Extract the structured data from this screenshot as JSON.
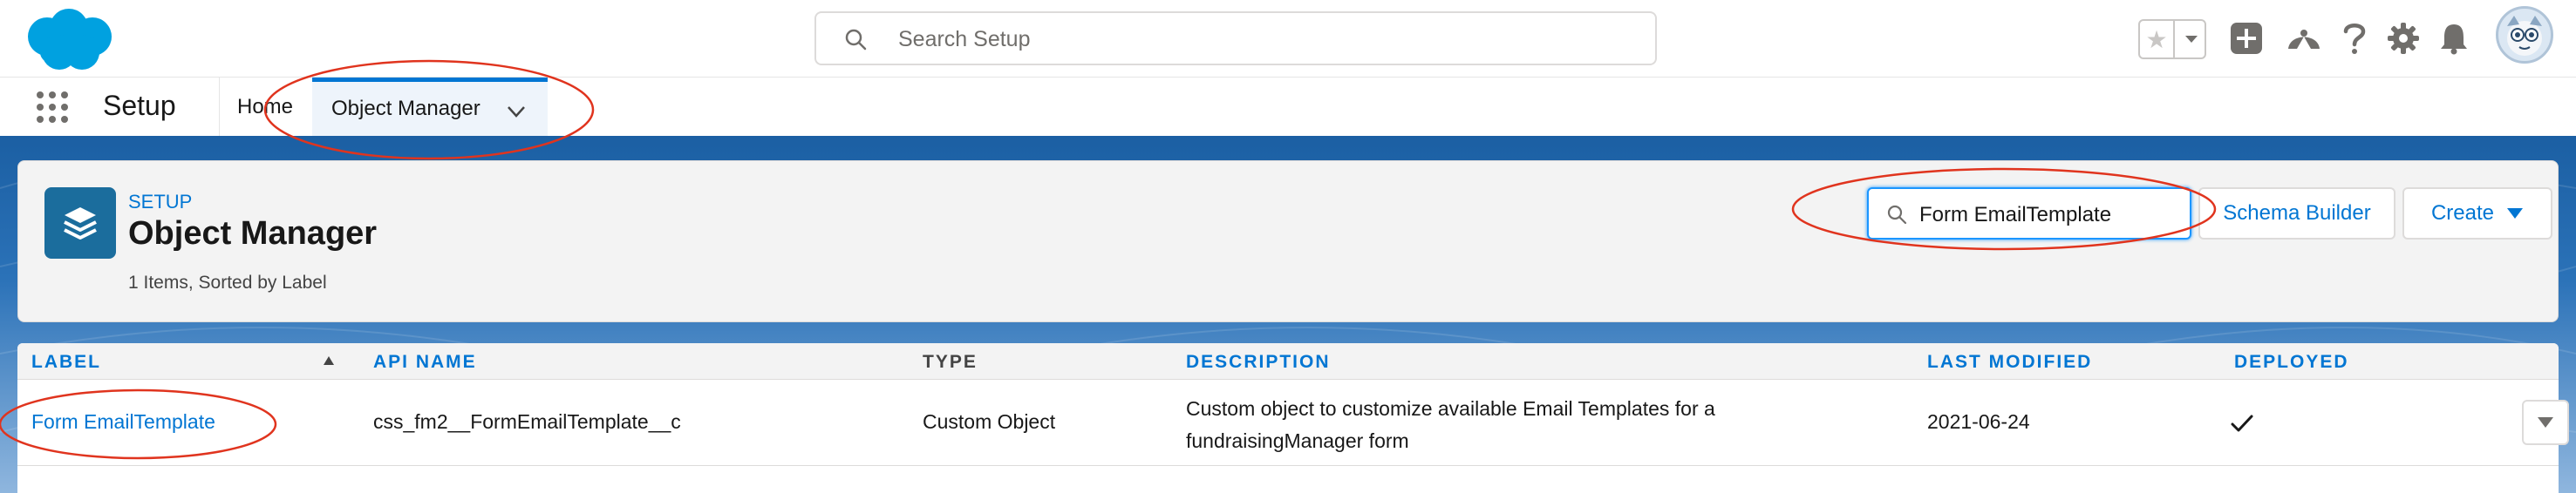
{
  "global_header": {
    "search_placeholder": "Search Setup"
  },
  "context_bar": {
    "app_name": "Setup",
    "tabs": [
      {
        "label": "Home"
      },
      {
        "label": "Object Manager"
      }
    ]
  },
  "page_header": {
    "eyebrow": "SETUP",
    "title": "Object Manager",
    "meta": "1 Items, Sorted by Label",
    "quick_find_value": "Form EmailTemplate",
    "schema_builder_label": "Schema Builder",
    "create_label": "Create"
  },
  "table": {
    "columns": [
      "LABEL",
      "API NAME",
      "TYPE",
      "DESCRIPTION",
      "LAST MODIFIED",
      "DEPLOYED"
    ],
    "rows": [
      {
        "label": "Form EmailTemplate",
        "api_name": "css_fm2__FormEmailTemplate__c",
        "type": "Custom Object",
        "description_line1": "Custom object to customize available Email Templates for a",
        "description_line2": "fundraisingManager form",
        "last_modified": "2021-06-24",
        "deployed": true
      }
    ]
  },
  "colors": {
    "brand_blue": "#0176d3",
    "annotation_red": "#e0341e",
    "header_band": "#1b5fa3"
  },
  "icons": [
    "salesforce-cloud-logo",
    "search-icon",
    "star-icon",
    "add-icon",
    "trailhead-icon",
    "help-icon",
    "gear-icon",
    "bell-icon",
    "app-launcher-icon",
    "layers-icon",
    "chevron-down-icon",
    "check-icon"
  ]
}
